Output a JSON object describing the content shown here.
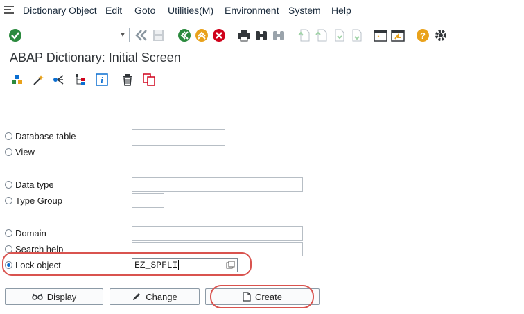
{
  "menu": {
    "items": [
      "Dictionary Object",
      "Edit",
      "Goto",
      "Utilities(M)",
      "Environment",
      "System",
      "Help"
    ]
  },
  "toolbar": {
    "command_value": "",
    "icons": [
      "enter-icon",
      "command-field",
      "back-double-icon",
      "save-icon",
      "back-icon",
      "exit-icon",
      "cancel-icon",
      "print-icon",
      "find-icon",
      "find-next-icon",
      "first-page-icon",
      "previous-page-icon",
      "next-page-icon",
      "last-page-icon",
      "new-session-icon",
      "shortcut-icon",
      "help-icon",
      "settings-icon"
    ]
  },
  "page": {
    "title": "ABAP Dictionary: Initial Screen"
  },
  "app_toolbar": {
    "icons": [
      "other-object-icon",
      "magic-wand-icon",
      "where-used-icon",
      "object-tree-icon",
      "info-icon",
      "delete-icon",
      "copy-icon"
    ]
  },
  "form": {
    "options": [
      {
        "label": "Database table",
        "value": "",
        "selected": false
      },
      {
        "label": "View",
        "value": "",
        "selected": false
      },
      {
        "label": "Data type",
        "value": "",
        "selected": false
      },
      {
        "label": "Type Group",
        "value": "",
        "selected": false
      },
      {
        "label": "Domain",
        "value": "",
        "selected": false
      },
      {
        "label": "Search help",
        "value": "",
        "selected": false
      },
      {
        "label": "Lock object",
        "value": "EZ_SPFLI",
        "selected": true
      }
    ]
  },
  "buttons": {
    "display": "Display",
    "change": "Change",
    "create": "Create"
  },
  "colors": {
    "accent": "#0a6ed1",
    "highlight": "#d9534f",
    "green": "#2b8a3e",
    "orange": "#e9a21b",
    "red": "#d0021b"
  }
}
